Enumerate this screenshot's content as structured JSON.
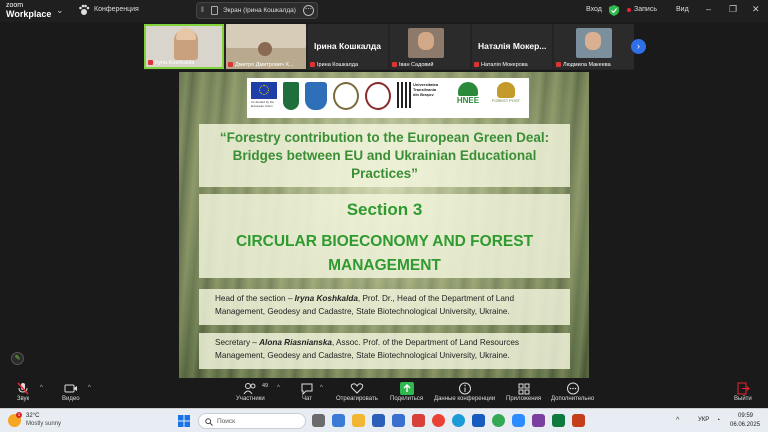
{
  "topbar": {
    "logo_line1": "zoom",
    "logo_line2": "Workplace",
    "conference_label": "Конференция",
    "share_label": "Экран (Ірина Кошкалда)",
    "login_label": "Вход",
    "record_label": "Запись",
    "view_label": "Вид"
  },
  "participants": [
    {
      "name": "Iryna Koshkalda",
      "active": true
    },
    {
      "name": "Дмитро Дмитрович Х..."
    },
    {
      "name": "Ірина Кошкалда",
      "big_label": "Ірина Кошкалда"
    },
    {
      "name": "Іван Садовий"
    },
    {
      "name": "Наталія Мокерова",
      "big_label": "Наталія Мокер..."
    },
    {
      "name": "Людмила Макеева"
    }
  ],
  "slide": {
    "title": "“Forestry contribution to the European Green Deal: Bridges between EU and Ukrainian Educational Practices”",
    "section": "Section 3",
    "section_sub": "CIRCULAR BIOECONOMY AND FOREST MANAGEMENT",
    "head_prefix": "Head of the section – ",
    "head_name": "Iryna Koshkalda",
    "head_rest": ", Prof. Dr., Head of the Department of Land Management, Geodesy and Cadastre, State Biotechnological University, Ukraine.",
    "secretary_prefix": "Secretary – ",
    "secretary_name": "Alona Riasnianska",
    "secretary_rest": ", Assoc. Prof. of the Department of Land Resources Management, Geodesy and Cadastre, State Biotechnological University, Ukraine.",
    "logo_eu_caption": "Co-funded by the European Union",
    "logo_brasov_1": "Universitatea",
    "logo_brasov_2": "Transilvania",
    "logo_brasov_3": "din Braşov",
    "logo_hnee": "HNEE",
    "logo_forest": "FOREST POST"
  },
  "toolbar": {
    "sound": "Звук",
    "video": "Видео",
    "participants": "Участники",
    "participants_count": "49",
    "chat": "Чат",
    "react": "Отреагировать",
    "share": "Поделиться",
    "conf_data": "Данные конференции",
    "apps": "Приложения",
    "more": "Дополнительно",
    "leave": "Выйти"
  },
  "taskbar": {
    "weather_temp": "32°C",
    "weather_desc": "Mostly sunny",
    "weather_badge": "1",
    "search_placeholder": "Поиск",
    "lang": "УКР",
    "time": "09:59",
    "date": "06.06.2025"
  },
  "colors": {
    "accent_green": "#2f9a2f",
    "active_border": "#7fd23c",
    "share_green": "#2fb84d",
    "next_blue": "#2f6fe8"
  }
}
